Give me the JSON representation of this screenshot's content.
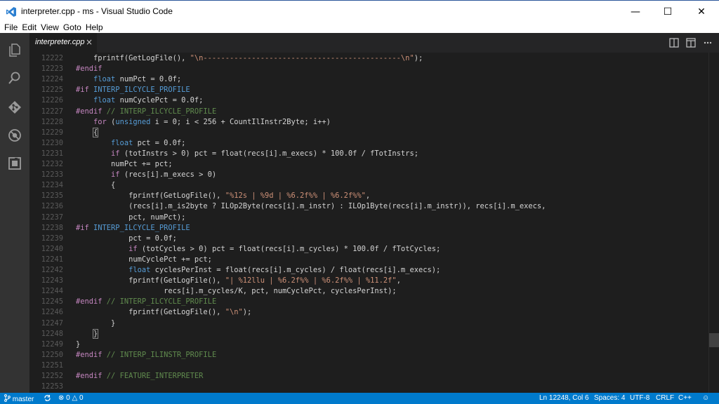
{
  "window": {
    "title": "interpreter.cpp - ms - Visual Studio Code",
    "minimize_glyph": "—",
    "maximize_glyph": "☐",
    "close_glyph": "✕"
  },
  "menu": [
    "File",
    "Edit",
    "View",
    "Goto",
    "Help"
  ],
  "activity_icons": [
    "explorer-icon",
    "search-icon",
    "git-icon",
    "debug-icon",
    "extensions-icon"
  ],
  "tab": {
    "label": "interpreter.cpp",
    "close_glyph": "×"
  },
  "editor_actions": [
    "split-editor-icon",
    "more-icon"
  ],
  "colors": {
    "accent": "#007acc",
    "keyword": "#569cd6",
    "preprocessor": "#c586c0",
    "string": "#ce9178",
    "comment": "#608b4e"
  },
  "code_lines": [
    {
      "n": "12222",
      "tokens": [
        [
          "t",
          "    fprintf(GetLogFile(), "
        ],
        [
          "s",
          "\"\\n---------------------------------------------\\n\""
        ],
        [
          "t",
          ");"
        ]
      ]
    },
    {
      "n": "12223",
      "tokens": [
        [
          "p",
          "#endif"
        ]
      ]
    },
    {
      "n": "12224",
      "tokens": [
        [
          "t",
          "    "
        ],
        [
          "k",
          "float"
        ],
        [
          "t",
          " numPct = 0.0f;"
        ]
      ]
    },
    {
      "n": "12225",
      "tokens": [
        [
          "p",
          "#if "
        ],
        [
          "k",
          "INTERP_ILCYCLE_PROFILE"
        ]
      ]
    },
    {
      "n": "12226",
      "tokens": [
        [
          "t",
          "    "
        ],
        [
          "k",
          "float"
        ],
        [
          "t",
          " numCyclePct = 0.0f;"
        ]
      ]
    },
    {
      "n": "12227",
      "tokens": [
        [
          "p",
          "#endif"
        ],
        [
          "c",
          " // INTERP_ILCYCLE_PROFILE"
        ]
      ]
    },
    {
      "n": "12228",
      "tokens": [
        [
          "t",
          "    "
        ],
        [
          "p",
          "for"
        ],
        [
          "t",
          " ("
        ],
        [
          "k",
          "unsigned"
        ],
        [
          "t",
          " i = 0; i < 256 + CountIlInstr2Byte; i++)"
        ]
      ]
    },
    {
      "n": "12229",
      "tokens": [
        [
          "t",
          "    "
        ],
        [
          "b",
          "{"
        ]
      ]
    },
    {
      "n": "12230",
      "tokens": [
        [
          "t",
          "        "
        ],
        [
          "k",
          "float"
        ],
        [
          "t",
          " pct = 0.0f;"
        ]
      ]
    },
    {
      "n": "12231",
      "tokens": [
        [
          "t",
          "        "
        ],
        [
          "p",
          "if"
        ],
        [
          "t",
          " (totInstrs > 0) pct = float(recs[i].m_execs) * 100.0f / fTotInstrs;"
        ]
      ]
    },
    {
      "n": "12232",
      "tokens": [
        [
          "t",
          "        numPct += pct;"
        ]
      ]
    },
    {
      "n": "12233",
      "tokens": [
        [
          "t",
          "        "
        ],
        [
          "p",
          "if"
        ],
        [
          "t",
          " (recs[i].m_execs > 0)"
        ]
      ]
    },
    {
      "n": "12234",
      "tokens": [
        [
          "t",
          "        {"
        ]
      ]
    },
    {
      "n": "12235",
      "tokens": [
        [
          "t",
          "            fprintf(GetLogFile(), "
        ],
        [
          "s",
          "\"%12s | %9d | %6.2f%% | %6.2f%%\""
        ],
        [
          "t",
          ","
        ]
      ]
    },
    {
      "n": "12236",
      "tokens": [
        [
          "t",
          "            (recs[i].m_is2byte ? ILOp2Byte(recs[i].m_instr) : ILOp1Byte(recs[i].m_instr)), recs[i].m_execs,"
        ]
      ]
    },
    {
      "n": "12237",
      "tokens": [
        [
          "t",
          "            pct, numPct);"
        ]
      ]
    },
    {
      "n": "12238",
      "tokens": [
        [
          "p",
          "#if "
        ],
        [
          "k",
          "INTERP_ILCYCLE_PROFILE"
        ]
      ]
    },
    {
      "n": "12239",
      "tokens": [
        [
          "t",
          "            pct = 0.0f;"
        ]
      ]
    },
    {
      "n": "12240",
      "tokens": [
        [
          "t",
          "            "
        ],
        [
          "p",
          "if"
        ],
        [
          "t",
          " (totCycles > 0) pct = float(recs[i].m_cycles) * 100.0f / fTotCycles;"
        ]
      ]
    },
    {
      "n": "12241",
      "tokens": [
        [
          "t",
          "            numCyclePct += pct;"
        ]
      ]
    },
    {
      "n": "12242",
      "tokens": [
        [
          "t",
          "            "
        ],
        [
          "k",
          "float"
        ],
        [
          "t",
          " cyclesPerInst = float(recs[i].m_cycles) / float(recs[i].m_execs);"
        ]
      ]
    },
    {
      "n": "12243",
      "tokens": [
        [
          "t",
          "            fprintf(GetLogFile(), "
        ],
        [
          "s",
          "\"| %12llu | %6.2f%% | %6.2f%% | %11.2f\""
        ],
        [
          "t",
          ","
        ]
      ]
    },
    {
      "n": "12244",
      "tokens": [
        [
          "t",
          "                    recs[i].m_cycles/K, pct, numCyclePct, cyclesPerInst);"
        ]
      ]
    },
    {
      "n": "12245",
      "tokens": [
        [
          "p",
          "#endif"
        ],
        [
          "c",
          " // INTERP_ILCYCLE_PROFILE"
        ]
      ]
    },
    {
      "n": "12246",
      "tokens": [
        [
          "t",
          "            fprintf(GetLogFile(), "
        ],
        [
          "s",
          "\"\\n\""
        ],
        [
          "t",
          ");"
        ]
      ]
    },
    {
      "n": "12247",
      "tokens": [
        [
          "t",
          "        }"
        ]
      ]
    },
    {
      "n": "12248",
      "tokens": [
        [
          "t",
          "    "
        ],
        [
          "b",
          "}"
        ]
      ]
    },
    {
      "n": "12249",
      "tokens": [
        [
          "t",
          "}"
        ]
      ]
    },
    {
      "n": "12250",
      "tokens": [
        [
          "p",
          "#endif"
        ],
        [
          "c",
          " // INTERP_ILINSTR_PROFILE"
        ]
      ]
    },
    {
      "n": "12251",
      "tokens": []
    },
    {
      "n": "12252",
      "tokens": [
        [
          "p",
          "#endif"
        ],
        [
          "c",
          " // FEATURE_INTERPRETER"
        ]
      ]
    },
    {
      "n": "12253",
      "tokens": []
    }
  ],
  "status": {
    "branch": "master",
    "errors": "0",
    "warnings": "0",
    "position": "Ln 12248, Col 6",
    "spaces": "Spaces: 4",
    "encoding": "UTF-8",
    "eol": "CRLF",
    "language": "C++"
  }
}
